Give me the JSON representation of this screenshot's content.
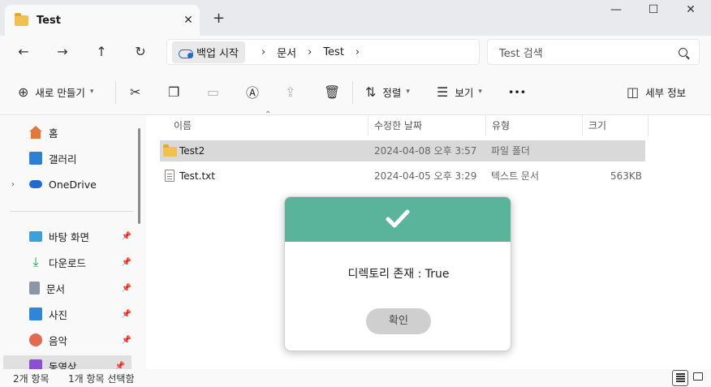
{
  "window": {
    "tab_title": "Test",
    "tab_close": "✕",
    "new_tab": "+",
    "minimize": "—",
    "maximize": "☐",
    "close": "✕"
  },
  "nav": {
    "back": "←",
    "forward": "→",
    "up": "↑",
    "refresh": "↻"
  },
  "address": {
    "root": "백업 시작",
    "crumbs": [
      "문서",
      "Test"
    ],
    "search_placeholder": "Test 검색"
  },
  "toolbar": {
    "new_label": "새로 만들기",
    "sort_label": "정렬",
    "view_label": "보기",
    "more": "•••",
    "details_label": "세부 정보"
  },
  "sidebar": {
    "top": [
      {
        "label": "홈",
        "icon": "home-icon"
      },
      {
        "label": "갤러리",
        "icon": "gallery-icon"
      },
      {
        "label": "OneDrive",
        "icon": "onedrive-icon"
      }
    ],
    "pinned": [
      {
        "label": "바탕 화면",
        "icon": "desktop-icon"
      },
      {
        "label": "다운로드",
        "icon": "download-icon"
      },
      {
        "label": "문서",
        "icon": "documents-icon"
      },
      {
        "label": "사진",
        "icon": "pictures-icon"
      },
      {
        "label": "음악",
        "icon": "music-icon"
      },
      {
        "label": "동영상",
        "icon": "videos-icon"
      }
    ]
  },
  "list": {
    "columns": [
      "이름",
      "수정한 날짜",
      "유형",
      "크기"
    ],
    "rows": [
      {
        "name": "Test2",
        "date": "2024-04-08 오후 3:57",
        "type": "파일 폴더",
        "size": ""
      },
      {
        "name": "Test.txt",
        "date": "2024-04-05 오후 3:29",
        "type": "텍스트 문서",
        "size": "563KB"
      }
    ]
  },
  "status": {
    "count": "2개 항목",
    "selected": "1개 항목 선택함"
  },
  "dialog": {
    "message": "디렉토리 존재 : True",
    "confirm_label": "확인"
  },
  "colors": {
    "dialog_header": "#5ab49c",
    "folder": "#f2c14b",
    "accent": "#1f6bd1"
  }
}
